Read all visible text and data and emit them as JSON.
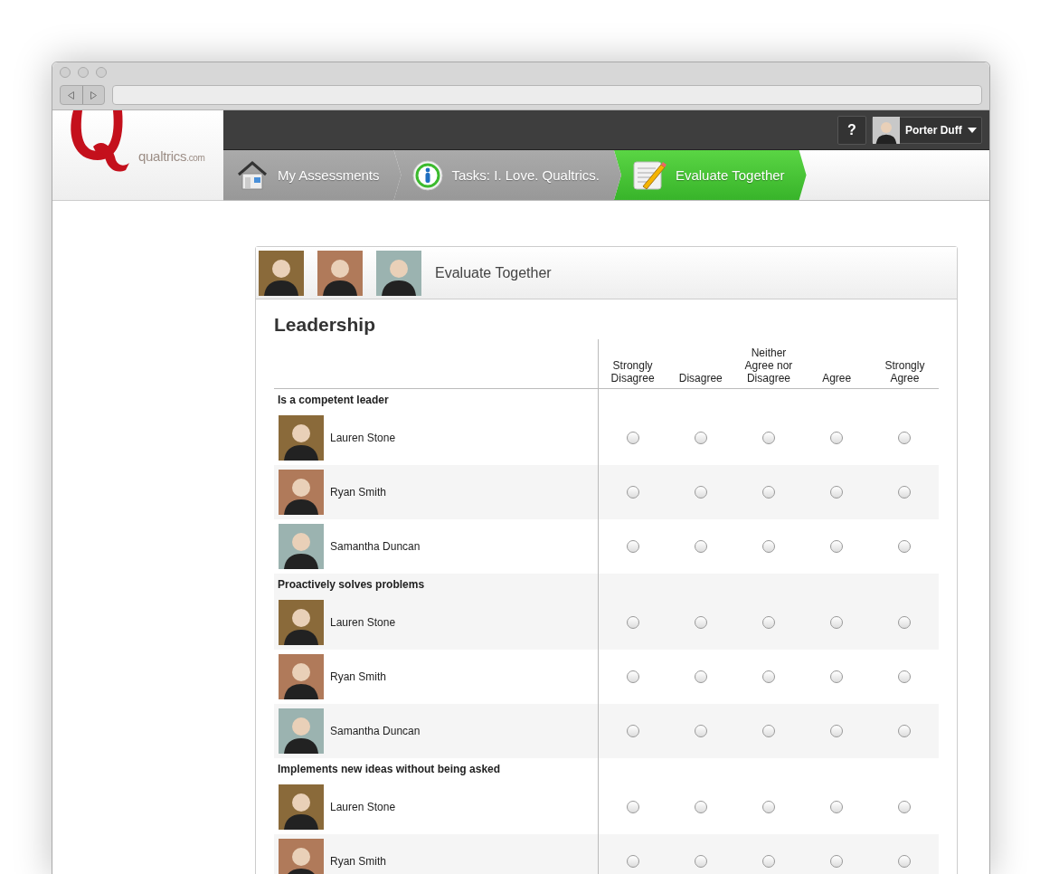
{
  "logo": {
    "wordmark": "qualtrics",
    "suffix": ".com"
  },
  "top_bar": {
    "help": "?",
    "user": "Porter Duff"
  },
  "breadcrumbs": [
    {
      "label": "My Assessments",
      "selected": false
    },
    {
      "label": "Tasks: I. Love. Qualtrics.",
      "selected": false
    },
    {
      "label": "Evaluate Together",
      "selected": true
    }
  ],
  "card": {
    "title": "Evaluate Together",
    "section": "Leadership",
    "columns": [
      "Strongly Disagree",
      "Disagree",
      "Neither Agree nor Disagree",
      "Agree",
      "Strongly Agree"
    ],
    "questions": [
      {
        "label": "Is a competent leader",
        "rows": [
          {
            "name": "Lauren Stone",
            "choices": [
              {
                "selected": false
              },
              {
                "selected": false
              },
              {
                "selected": false
              },
              {
                "selected": false
              },
              {
                "selected": false
              }
            ]
          },
          {
            "name": "Ryan Smith",
            "choices": [
              {
                "selected": false
              },
              {
                "selected": false
              },
              {
                "selected": false
              },
              {
                "selected": false
              },
              {
                "selected": false
              }
            ]
          },
          {
            "name": "Samantha Duncan",
            "choices": [
              {
                "selected": false
              },
              {
                "selected": false
              },
              {
                "selected": false
              },
              {
                "selected": false
              },
              {
                "selected": false
              }
            ]
          }
        ]
      },
      {
        "label": "Proactively solves problems",
        "rows": [
          {
            "name": "Lauren Stone",
            "choices": [
              {
                "selected": false
              },
              {
                "selected": false
              },
              {
                "selected": false
              },
              {
                "selected": false
              },
              {
                "selected": false
              }
            ]
          },
          {
            "name": "Ryan Smith",
            "choices": [
              {
                "selected": false
              },
              {
                "selected": false
              },
              {
                "selected": false
              },
              {
                "selected": false
              },
              {
                "selected": false
              }
            ]
          },
          {
            "name": "Samantha Duncan",
            "choices": [
              {
                "selected": false
              },
              {
                "selected": false
              },
              {
                "selected": false
              },
              {
                "selected": false
              },
              {
                "selected": false
              }
            ]
          }
        ]
      },
      {
        "label": "Implements new ideas without being asked",
        "rows": [
          {
            "name": "Lauren Stone",
            "choices": [
              {
                "selected": false
              },
              {
                "selected": false
              },
              {
                "selected": false
              },
              {
                "selected": false
              },
              {
                "selected": false
              }
            ]
          },
          {
            "name": "Ryan Smith",
            "choices": [
              {
                "selected": false
              },
              {
                "selected": false
              },
              {
                "selected": false
              },
              {
                "selected": false
              },
              {
                "selected": false
              }
            ]
          }
        ]
      }
    ]
  }
}
